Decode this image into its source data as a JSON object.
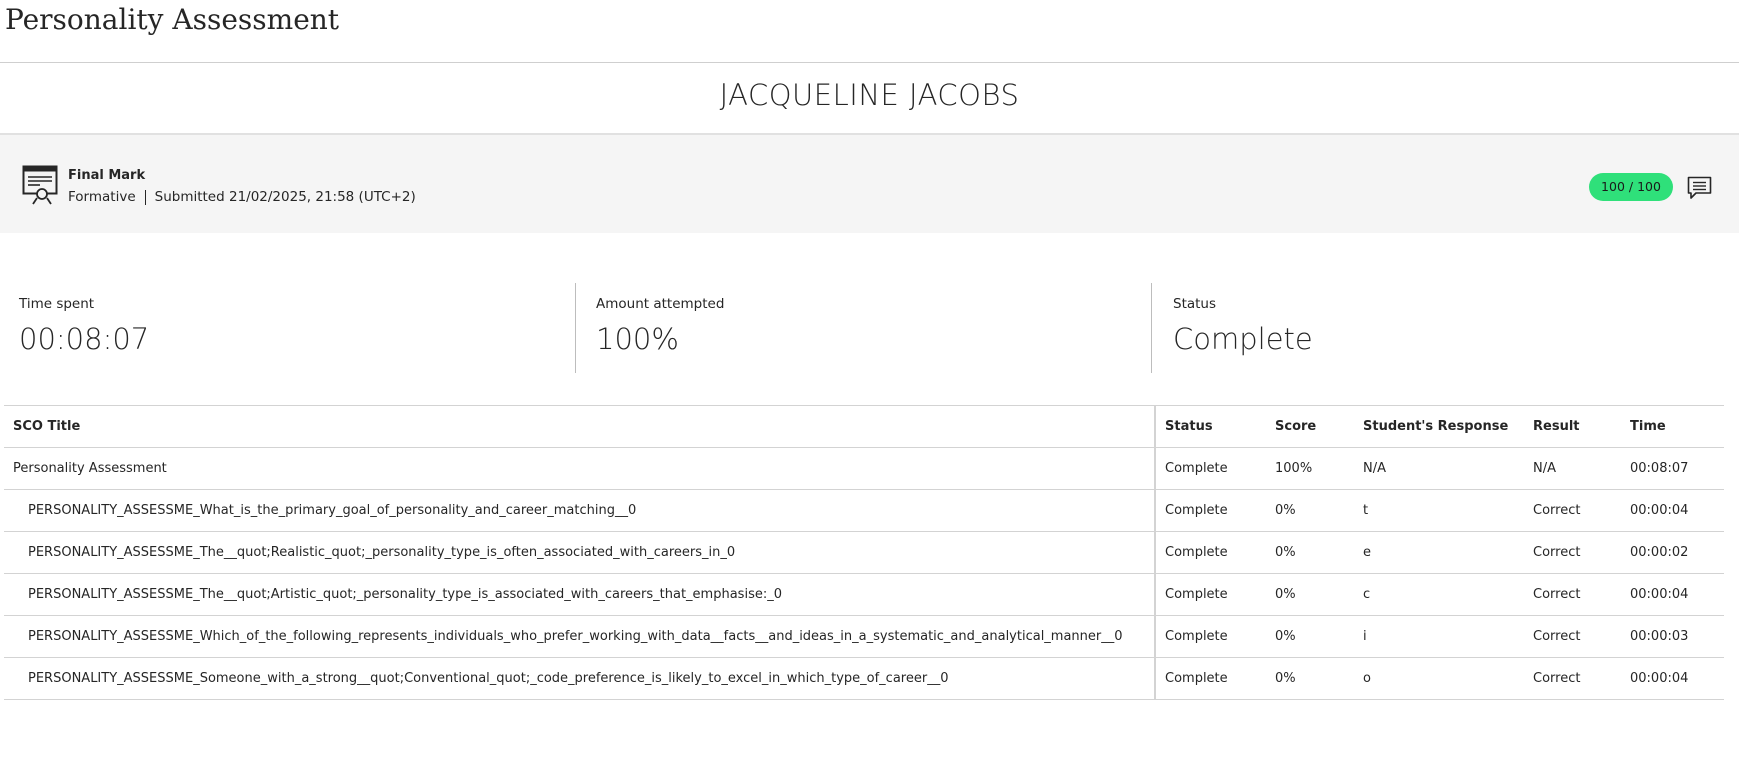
{
  "page": {
    "title": "Personality Assessment",
    "student_name": "JACQUELINE JACOBS"
  },
  "final_mark": {
    "label": "Final Mark",
    "type": "Formative",
    "submitted": "Submitted 21/02/2025, 21:58 (UTC+2)",
    "score": "100 / 100",
    "score_color": "#2fe07a",
    "icons": {
      "certificate": "certificate-icon",
      "feedback": "feedback-comment-icon"
    }
  },
  "stats": {
    "time_spent": {
      "label": "Time spent",
      "value": "00:08:07"
    },
    "amount_attempted": {
      "label": "Amount attempted",
      "value": "100%"
    },
    "status": {
      "label": "Status",
      "value": "Complete"
    }
  },
  "table": {
    "headers": {
      "sco_title": "SCO Title",
      "status": "Status",
      "score": "Score",
      "response": "Student's Response",
      "result": "Result",
      "time": "Time"
    },
    "rows": [
      {
        "title": "Personality Assessment",
        "status": "Complete",
        "score": "100%",
        "response": "N/A",
        "result": "N/A",
        "time": "00:08:07"
      },
      {
        "title": "PERSONALITY_ASSESSME_What_is_the_primary_goal_of_personality_and_career_matching__0",
        "status": "Complete",
        "score": "0%",
        "response": "t",
        "result": "Correct",
        "time": "00:00:04"
      },
      {
        "title": "PERSONALITY_ASSESSME_The__quot;Realistic_quot;_personality_type_is_often_associated_with_careers_in_0",
        "status": "Complete",
        "score": "0%",
        "response": "e",
        "result": "Correct",
        "time": "00:00:02"
      },
      {
        "title": "PERSONALITY_ASSESSME_The__quot;Artistic_quot;_personality_type_is_associated_with_careers_that_emphasise:_0",
        "status": "Complete",
        "score": "0%",
        "response": "c",
        "result": "Correct",
        "time": "00:00:04"
      },
      {
        "title": "PERSONALITY_ASSESSME_Which_of_the_following_represents_individuals_who_prefer_working_with_data__facts__and_ideas_in_a_systematic_and_analytical_manner__0",
        "status": "Complete",
        "score": "0%",
        "response": "i",
        "result": "Correct",
        "time": "00:00:03"
      },
      {
        "title": "PERSONALITY_ASSESSME_Someone_with_a_strong__quot;Conventional_quot;_code_preference_is_likely_to_excel_in_which_type_of_career__0",
        "status": "Complete",
        "score": "0%",
        "response": "o",
        "result": "Correct",
        "time": "00:00:04"
      }
    ]
  }
}
